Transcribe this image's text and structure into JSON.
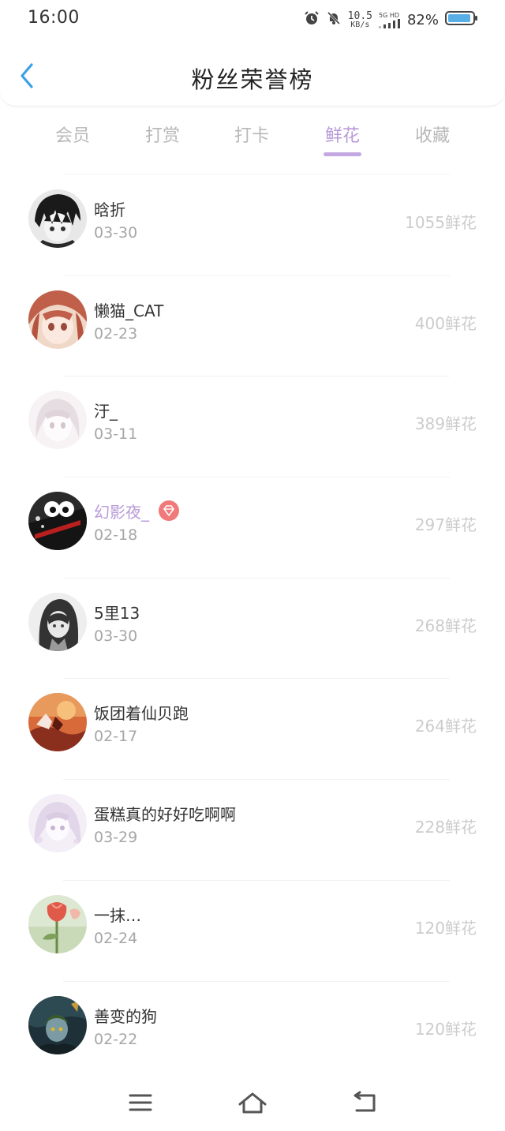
{
  "status_bar": {
    "time": "16:00",
    "net_speed_value": "10.5",
    "net_speed_unit": "KB/s",
    "network_label": "5G HD",
    "battery": "82%"
  },
  "header": {
    "title": "粉丝荣誉榜"
  },
  "tabs": [
    {
      "label": "会员",
      "active": false
    },
    {
      "label": "打赏",
      "active": false
    },
    {
      "label": "打卡",
      "active": false
    },
    {
      "label": "鲜花",
      "active": true
    },
    {
      "label": "收藏",
      "active": false
    }
  ],
  "colors": {
    "accent": "#b89ad8",
    "back_arrow": "#3aa0e8",
    "badge": "#f07a7a"
  },
  "fans": [
    {
      "name": "晗折",
      "date": "03-30",
      "flowers": "1055鲜花",
      "highlight": false,
      "badge": false
    },
    {
      "name": "懒猫_CAT",
      "date": "02-23",
      "flowers": "400鲜花",
      "highlight": false,
      "badge": false
    },
    {
      "name": "汙_",
      "date": "03-11",
      "flowers": "389鲜花",
      "highlight": false,
      "badge": false
    },
    {
      "name": "幻影夜_",
      "date": "02-18",
      "flowers": "297鲜花",
      "highlight": true,
      "badge": true
    },
    {
      "name": "5里13",
      "date": "03-30",
      "flowers": "268鲜花",
      "highlight": false,
      "badge": false
    },
    {
      "name": "饭团着仙贝跑",
      "date": "02-17",
      "flowers": "264鲜花",
      "highlight": false,
      "badge": false
    },
    {
      "name": "蛋糕真的好好吃啊啊",
      "date": "03-29",
      "flowers": "228鲜花",
      "highlight": false,
      "badge": false
    },
    {
      "name": "一抹…",
      "date": "02-24",
      "flowers": "120鲜花",
      "highlight": false,
      "badge": false
    },
    {
      "name": "善变的狗",
      "date": "02-22",
      "flowers": "120鲜花",
      "highlight": false,
      "badge": false
    }
  ]
}
